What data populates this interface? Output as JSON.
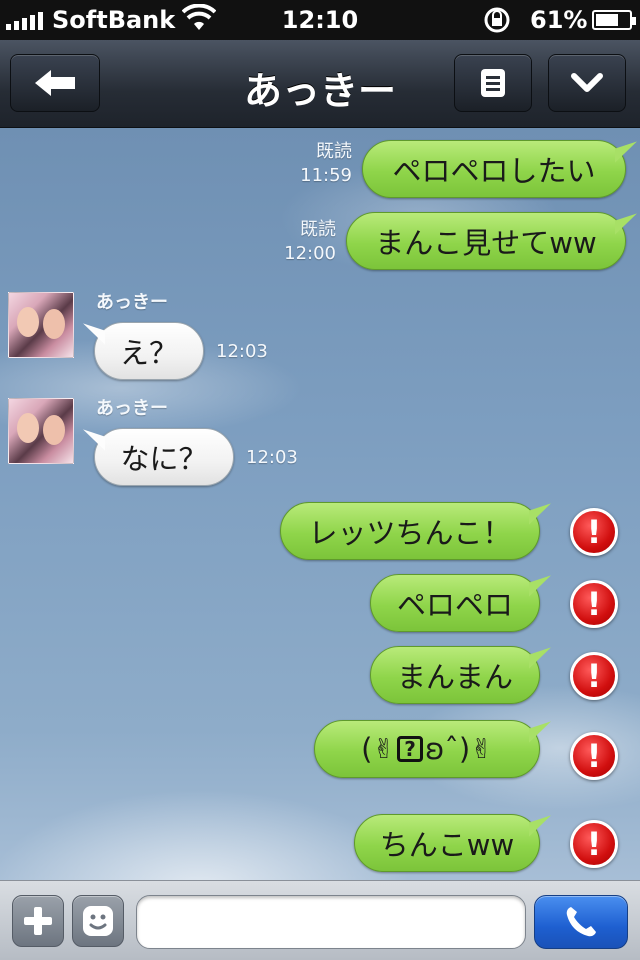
{
  "status_bar": {
    "carrier": "SoftBank",
    "time": "12:10",
    "battery_percent": "61%",
    "battery_level": 0.61,
    "icons": [
      "signal-icon",
      "wifi-icon",
      "rotation-lock-icon",
      "battery-icon"
    ]
  },
  "nav": {
    "title": "あっきー",
    "back_icon": "arrow-left-icon",
    "menu_icon": "list-icon",
    "more_icon": "chevron-down-icon"
  },
  "messages": [
    {
      "dir": "out",
      "text": "ペロペロしたい",
      "read": "既読",
      "time": "11:59"
    },
    {
      "dir": "out",
      "text": "まんこ見せてww",
      "read": "既読",
      "time": "12:00"
    },
    {
      "dir": "in",
      "sender": "あっきー",
      "text": "え？",
      "time": "12:03"
    },
    {
      "dir": "in",
      "sender": "あっきー",
      "text": "なに？",
      "time": "12:03"
    },
    {
      "dir": "out",
      "text": "レッツちんこ！",
      "status": "failed"
    },
    {
      "dir": "out",
      "text": "ペロペロ",
      "status": "failed"
    },
    {
      "dir": "out",
      "text": "まんまん",
      "status": "failed"
    },
    {
      "dir": "out",
      "text_parts": [
        "(",
        "✌",
        "?",
        "ʚ",
        "ˆ",
        ")",
        "✌"
      ],
      "status": "failed"
    },
    {
      "dir": "out",
      "text": "ちんこww",
      "status": "failed"
    }
  ],
  "error_mark": "!",
  "input_bar": {
    "text_value": "",
    "icons": [
      "plus-icon",
      "emoticon-icon",
      "phone-icon"
    ]
  },
  "colors": {
    "out_bubble": "#8fd54a",
    "in_bubble": "#ffffff",
    "error": "#d10f0f",
    "call_button": "#1e5fd0"
  }
}
